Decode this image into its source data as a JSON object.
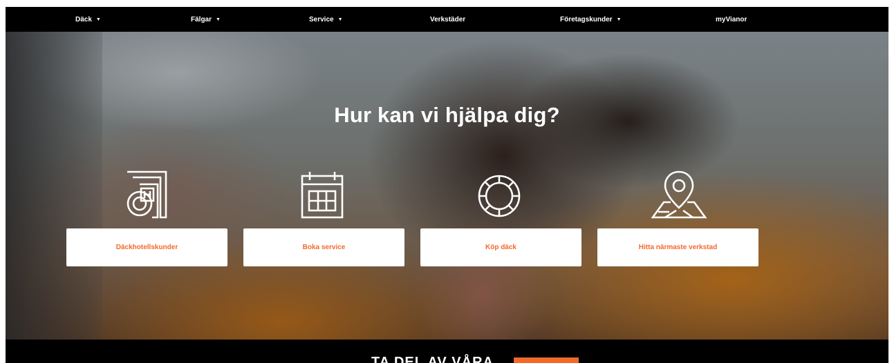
{
  "nav": {
    "items": [
      {
        "label": "Däck",
        "has_caret": true
      },
      {
        "label": "Fälgar",
        "has_caret": true
      },
      {
        "label": "Service",
        "has_caret": true
      },
      {
        "label": "Verkstäder",
        "has_caret": false
      },
      {
        "label": "Företagskunder",
        "has_caret": true
      },
      {
        "label": "myVianor",
        "has_caret": false
      }
    ],
    "caret": "▼"
  },
  "hero": {
    "title": "Hur kan vi hjälpa dig?"
  },
  "cards": [
    {
      "label": "Däckhotellskunder",
      "icon": "tire-hotel-icon"
    },
    {
      "label": "Boka service",
      "icon": "calendar-icon"
    },
    {
      "label": "Köp däck",
      "icon": "tire-icon"
    },
    {
      "label": "Hitta närmaste verkstad",
      "icon": "map-pin-icon"
    }
  ],
  "bottom": {
    "text": "TA DEL AV VÅRA"
  },
  "colors": {
    "accent": "#f4682a",
    "nav_bg": "#000000",
    "card_bg": "#ffffff"
  }
}
